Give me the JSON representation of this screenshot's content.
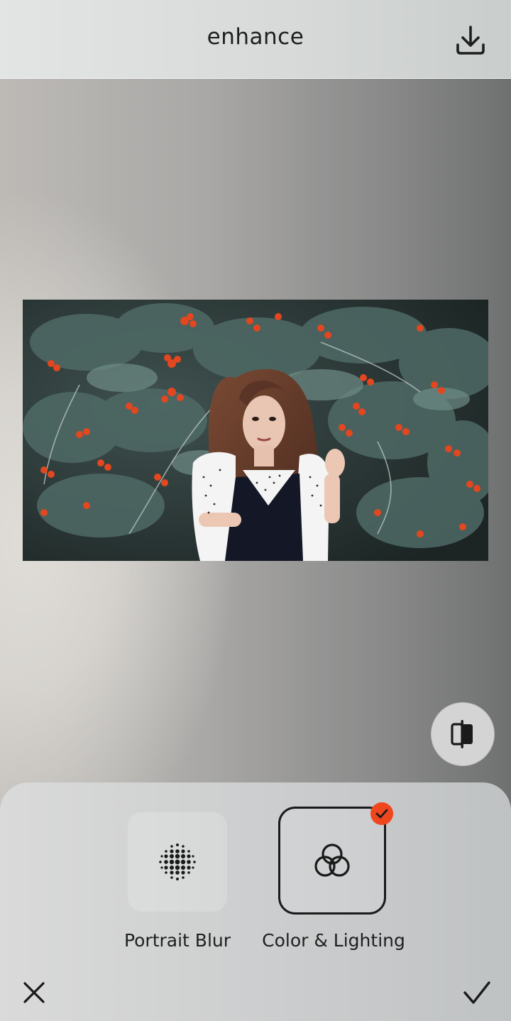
{
  "header": {
    "title": "enhance",
    "download_icon": "download-icon"
  },
  "photo": {
    "subject": "woman with curly hair in front of rowan tree"
  },
  "compare": {
    "icon": "compare-split-icon"
  },
  "tools": [
    {
      "label": "Portrait Blur",
      "icon": "portrait-blur-dots-icon",
      "selected": false
    },
    {
      "label": "Color & Lighting",
      "icon": "color-lighting-rings-icon",
      "selected": true
    }
  ],
  "footer": {
    "cancel_icon": "close-icon",
    "confirm_icon": "check-icon"
  },
  "colors": {
    "accent": "#f0461e",
    "text": "#1e1f1f"
  }
}
